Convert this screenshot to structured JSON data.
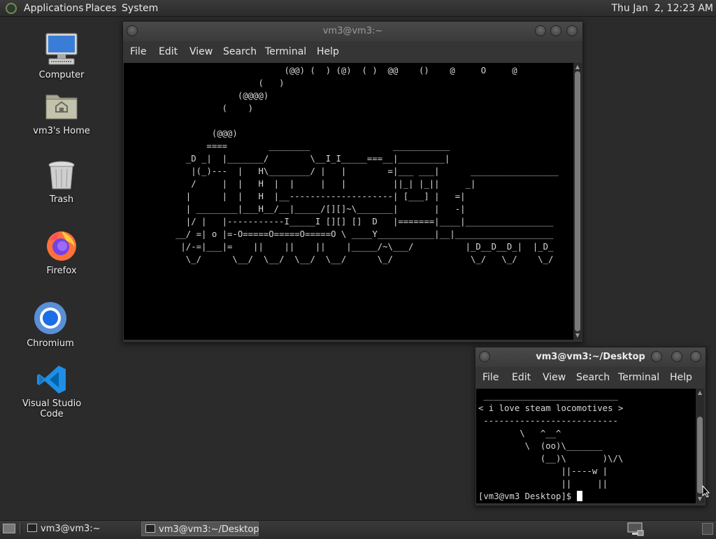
{
  "top_panel": {
    "menus": [
      "Applications",
      "Places",
      "System"
    ],
    "clock": "Thu Jan  2, 12:23 AM"
  },
  "desktop": {
    "icons": [
      {
        "label": "Computer",
        "icon": "computer-icon"
      },
      {
        "label": "vm3's Home",
        "icon": "home-folder-icon"
      },
      {
        "label": "Trash",
        "icon": "trash-icon"
      },
      {
        "label": "Firefox",
        "icon": "firefox-icon"
      },
      {
        "label": "Chromium",
        "icon": "chromium-icon"
      },
      {
        "label": "Visual Studio Code",
        "icon": "vscode-icon"
      }
    ]
  },
  "window_main": {
    "title": "vm3@vm3:~",
    "menu": [
      "File",
      "Edit",
      "View",
      "Search",
      "Terminal",
      "Help"
    ],
    "content": "                     (@@) (  ) (@)  ( )  @@    ()    @     O     @\n                (   )\n            (@@@@)\n         (    )\n\n       (@@@)\n      ====        ________                ___________\n  _D _|  |_______/        \\__I_I_____===__|_________|\n   |(_)---  |   H\\________/ |   |        =|___ ___|      _________________\n   /     |  |   H  |  |     |   |         ||_| |_||     _|\n  |      |  |   H  |__--------------------| [___] |   =|\n  | ________|___H__/__|_____/[][]~\\_______|       |   -|\n  |/ |   |-----------I_____I [][] []  D   |=======|____|_________________\n__/ =| o |=-O=====O=====O=====O \\ ____Y___________|__|___________________\n |/-=|___|=    ||    ||    ||    |_____/~\\___/          |_D__D__D_|  |_D_\n  \\_/      \\__/  \\__/  \\__/  \\__/      \\_/               \\_/   \\_/    \\_/"
  },
  "window_desktop": {
    "title": "vm3@vm3:~/Desktop",
    "menu": [
      "File",
      "Edit",
      "View",
      "Search",
      "Terminal",
      "Help"
    ],
    "content": " __________________________\n< i love steam locomotives >\n --------------------------\n        \\   ^__^\n         \\  (oo)\\_______\n            (__)\\       )\\/\\\n                ||----w |\n                ||     ||",
    "prompt": "[vm3@vm3 Desktop]$ "
  },
  "bottom_panel": {
    "tasks": [
      "vm3@vm3:~",
      "vm3@vm3:~/Desktop"
    ]
  }
}
